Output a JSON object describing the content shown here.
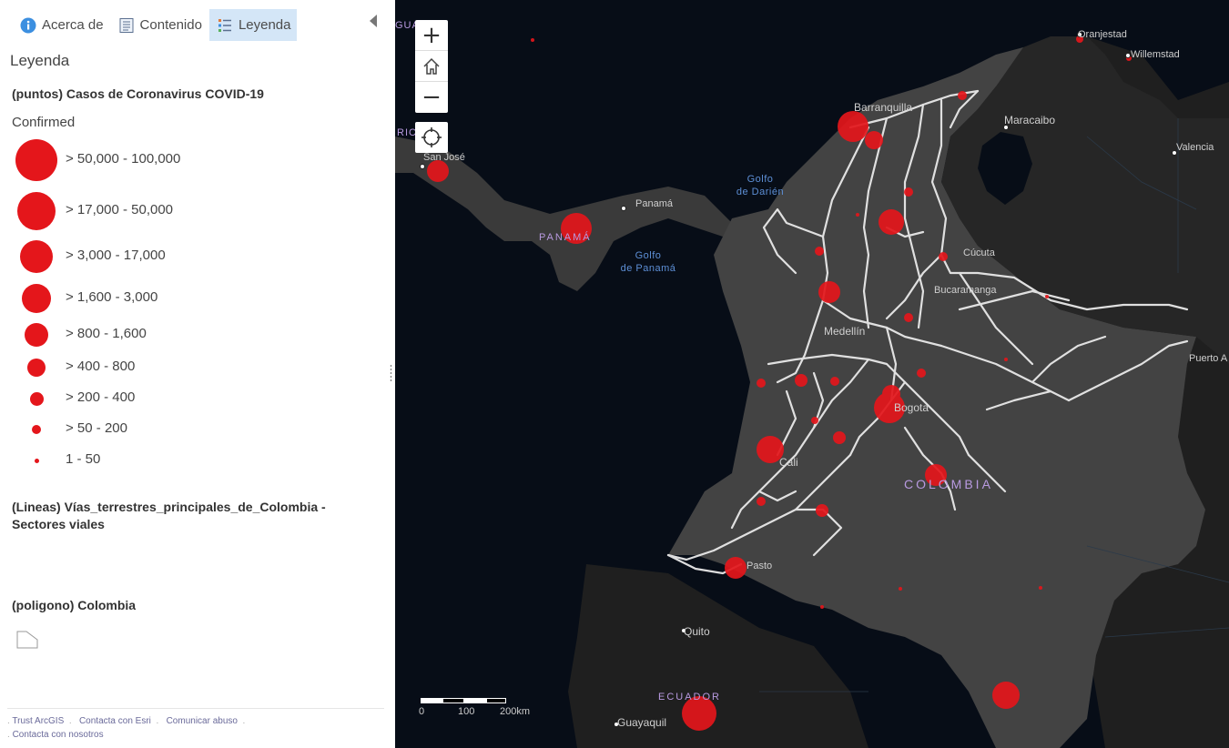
{
  "tabs": [
    {
      "label": "Acerca de",
      "icon": "info-icon"
    },
    {
      "label": "Contenido",
      "icon": "content-icon"
    },
    {
      "label": "Leyenda",
      "icon": "legend-icon",
      "active": true
    }
  ],
  "panel": {
    "title": "Leyenda"
  },
  "legend": {
    "points_layer": "(puntos) Casos de Coronavirus COVID-19",
    "field": "Confirmed",
    "classes": [
      {
        "label": "> 50,000 - 100,000"
      },
      {
        "label": "> 17,000 - 50,000"
      },
      {
        "label": "> 3,000 - 17,000"
      },
      {
        "label": "> 1,600 - 3,000"
      },
      {
        "label": "> 800 - 1,600"
      },
      {
        "label": "> 400 - 800"
      },
      {
        "label": "> 200 - 400"
      },
      {
        "label": "> 50 - 200"
      },
      {
        "label": "1 - 50"
      }
    ],
    "lines_layer": "(Lineas) Vías_terrestres_principales_de_Colombia - Sectores viales",
    "polygon_layer": "(poligono) Colombia",
    "symbol_color": "#e4161b"
  },
  "footer": {
    "links": [
      "Trust ArcGIS",
      "Contacta con Esri",
      "Comunicar abuso",
      "Contacta con nosotros"
    ]
  },
  "map": {
    "cities": [
      "Oranjestad",
      "Willemstad",
      "Barranquilla",
      "Maracaibo",
      "Valencia",
      "San José",
      "Panamá",
      "Cúcuta",
      "Bucaramanga",
      "Medellín",
      "Bogota",
      "Cali",
      "Pasto",
      "Quito",
      "Guayaquil",
      "Puerto A"
    ],
    "seas": [
      {
        "text": "Golfo de Darién"
      },
      {
        "text": "Golfo de Panamá"
      }
    ],
    "countries": [
      "PANAMÁ",
      "COLOMBIA",
      "ECUADOR",
      "GUA",
      "RIC"
    ],
    "scale": {
      "labels": [
        "0",
        "100",
        "200km"
      ]
    },
    "controls": {
      "zoom_in": "+",
      "zoom_out": "−"
    }
  }
}
